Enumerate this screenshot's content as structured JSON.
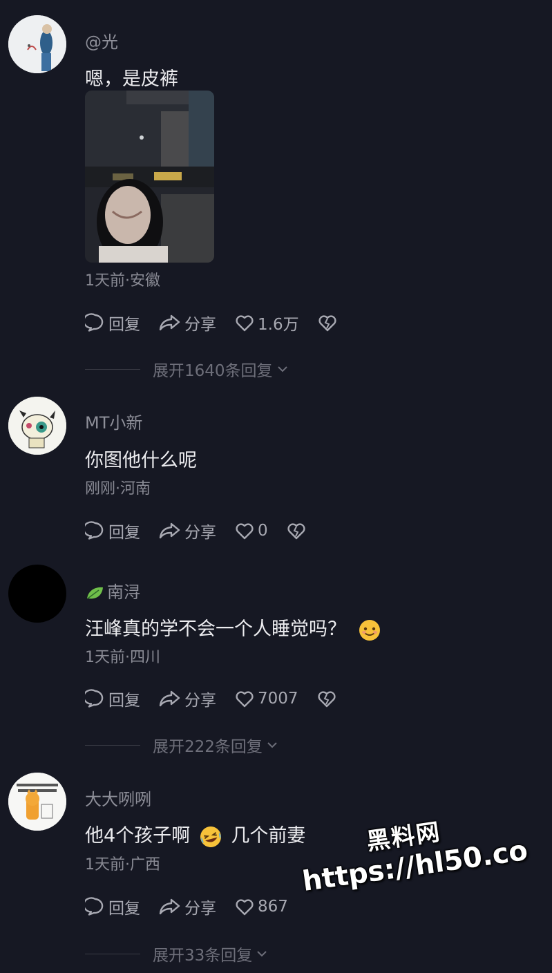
{
  "comments": [
    {
      "username": "@光",
      "text": "嗯，是皮裤",
      "meta": "1天前·安徽",
      "reply_label": "回复",
      "share_label": "分享",
      "likes": "1.6万",
      "expand": "展开1640条回复"
    },
    {
      "username": "MT小新",
      "text": "你图他什么呢",
      "meta": "刚刚·河南",
      "reply_label": "回复",
      "share_label": "分享",
      "likes": "0"
    },
    {
      "username": "南浔",
      "text": "汪峰真的学不会一个人睡觉吗？",
      "meta": "1天前·四川",
      "reply_label": "回复",
      "share_label": "分享",
      "likes": "7007",
      "expand": "展开222条回复"
    },
    {
      "username": "大大咧咧",
      "text_before": "他4个孩子啊",
      "text_after": "几个前妻",
      "meta": "1天前·广西",
      "reply_label": "回复",
      "share_label": "分享",
      "likes": "867",
      "expand": "展开33条回复"
    }
  ],
  "watermark": {
    "line1": "黑料网",
    "line2": "https://hl50.co"
  },
  "colors": {
    "background": "#161823",
    "meta_text": "#8a8b95",
    "action_text": "#a8a9b2"
  }
}
